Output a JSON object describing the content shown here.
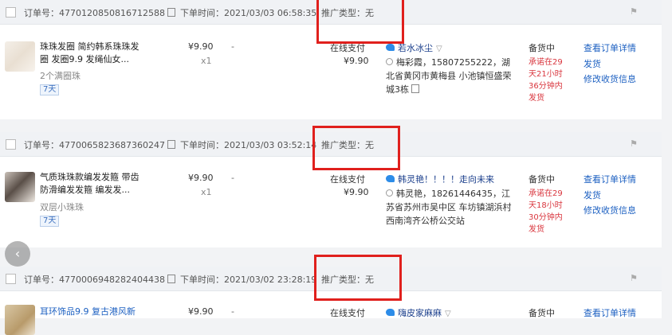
{
  "colors": {
    "accent": "#1b5fc1",
    "warning": "#d9363e",
    "highlight_box": "#e0201d"
  },
  "orders": [
    {
      "order_no": "订单号：4770120850816712588",
      "order_time": "下单时间：2021/03/03 06:58:35",
      "promo_type": "推广类型：无",
      "product_title": "珠珠发圈 简约韩系珠珠发圈 发圈9.9 发绳仙女...",
      "product_sub": "2个满圈珠",
      "tag": "7天",
      "price": "¥9.90",
      "qty": "x1",
      "dash": "-",
      "pay_method": "在线支付",
      "total": "¥9.90",
      "buyer": "若水冰尘",
      "address": "梅彩霞，15807255222，湖北省黄冈市黄梅县 小池镇恒盛荣城3栋",
      "status": "备货中",
      "promise": "承诺在29天21小时36分钟内发货",
      "link_detail": "查看订单详情",
      "link_ship": "发货",
      "link_addr": "修改收货信息"
    },
    {
      "order_no": "订单号：4770065823687360247",
      "order_time": "下单时间：2021/03/03 03:52:14",
      "promo_type": "推广类型：无",
      "product_title": "气质珠珠款编发发箍 带齿防滑编发发箍 编发发...",
      "product_sub": "双层小珠珠",
      "tag": "7天",
      "price": "¥9.90",
      "qty": "x1",
      "dash": "-",
      "pay_method": "在线支付",
      "total": "¥9.90",
      "buyer": "韩灵艳！！！！走向未来",
      "address": "韩灵艳，18261446435，江苏省苏州市吴中区 车坊镇湖浜村西南湾齐公桥公交站",
      "status": "备货中",
      "promise": "承诺在29天18小时30分钟内发货",
      "link_detail": "查看订单详情",
      "link_ship": "发货",
      "link_addr": "修改收货信息"
    },
    {
      "order_no": "订单号：4770006948282404438",
      "order_time": "下单时间：2021/03/02 23:28:19",
      "promo_type": "推广类型：无",
      "product_title": "耳环饰品9.9 复古港风新",
      "price": "¥9.90",
      "dash": "-",
      "pay_method": "在线支付",
      "buyer": "嗨皮家麻麻",
      "status": "备货中",
      "link_detail": "查看订单详情"
    }
  ]
}
